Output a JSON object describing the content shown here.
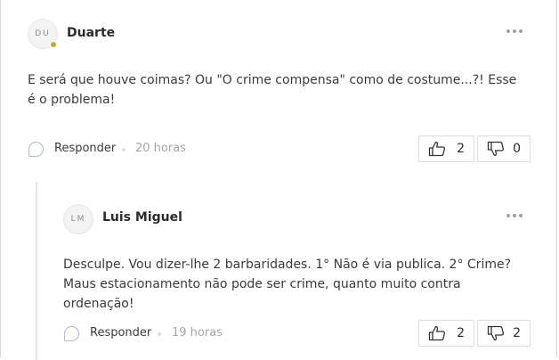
{
  "comments": [
    {
      "initials": "DU",
      "author": "Duarte",
      "text": "E será que houve coimas? Ou \"O crime compensa\" como de costume...?! Esse é o problema!",
      "reply_label": "Responder",
      "time": "20 horas",
      "likes": "2",
      "dislikes": "0"
    },
    {
      "initials": "LM",
      "author": "Luis Miguel",
      "text": "Desculpe. Vou dizer-lhe 2 barbaridades. 1° Não é via publica. 2° Crime? Maus estacionamento não pode ser crime, quanto muito contra ordenação!",
      "reply_label": "Responder",
      "time": "19 horas",
      "likes": "2",
      "dislikes": "2"
    }
  ],
  "icons": {
    "like": "thumbs-up-icon",
    "dislike": "thumbs-down-icon",
    "reply": "reply-bubble-icon",
    "more": "more-options-icon"
  },
  "colors": {
    "status_dot": "#c9a820",
    "reply_icon": "#a9b9d3"
  }
}
